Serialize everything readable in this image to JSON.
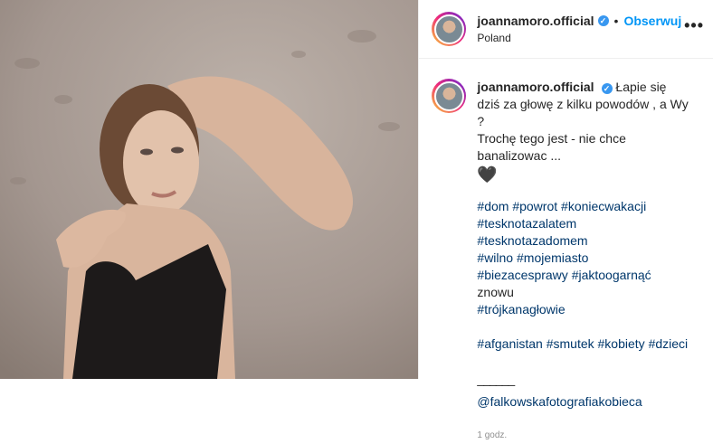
{
  "header": {
    "username": "joannamoro.official",
    "verified_mark": "✓",
    "separator": "•",
    "follow_label": "Obserwuj",
    "location": "Poland",
    "more_label": "•••"
  },
  "caption": {
    "username": "joannamoro.official",
    "text_lines": [
      "Łapie się dziś za głowę z kilku powodów , a Wy ?",
      "Trochę tego jest - nie chce banalizowac ..."
    ],
    "heart_icon": "black-heart-icon",
    "heart_glyph": "🖤",
    "hashtags_1": [
      [
        "#dom",
        "#powrot",
        "#koniecwakacji"
      ],
      [
        "#tesknotazalatem",
        "#tesknotazadomem"
      ],
      [
        "#wilno",
        "#mojemiasto"
      ],
      [
        "#biezacesprawy",
        "#jaktoogarnąć"
      ],
      [
        "#trójkanagłowie"
      ]
    ],
    "hashtags_1_suffix_word": "znowu",
    "hashtags_2": [
      "#afganistan",
      "#smutek",
      "#kobiety",
      "#dzieci"
    ],
    "rule": "______",
    "mention": "@falkowskafotografiakobieca",
    "timestamp": "1 godz."
  },
  "colors": {
    "link_blue": "#0095f6",
    "hashtag": "#00376b",
    "text": "#262626",
    "muted": "#8e8e8e",
    "verified": "#3897f0"
  }
}
